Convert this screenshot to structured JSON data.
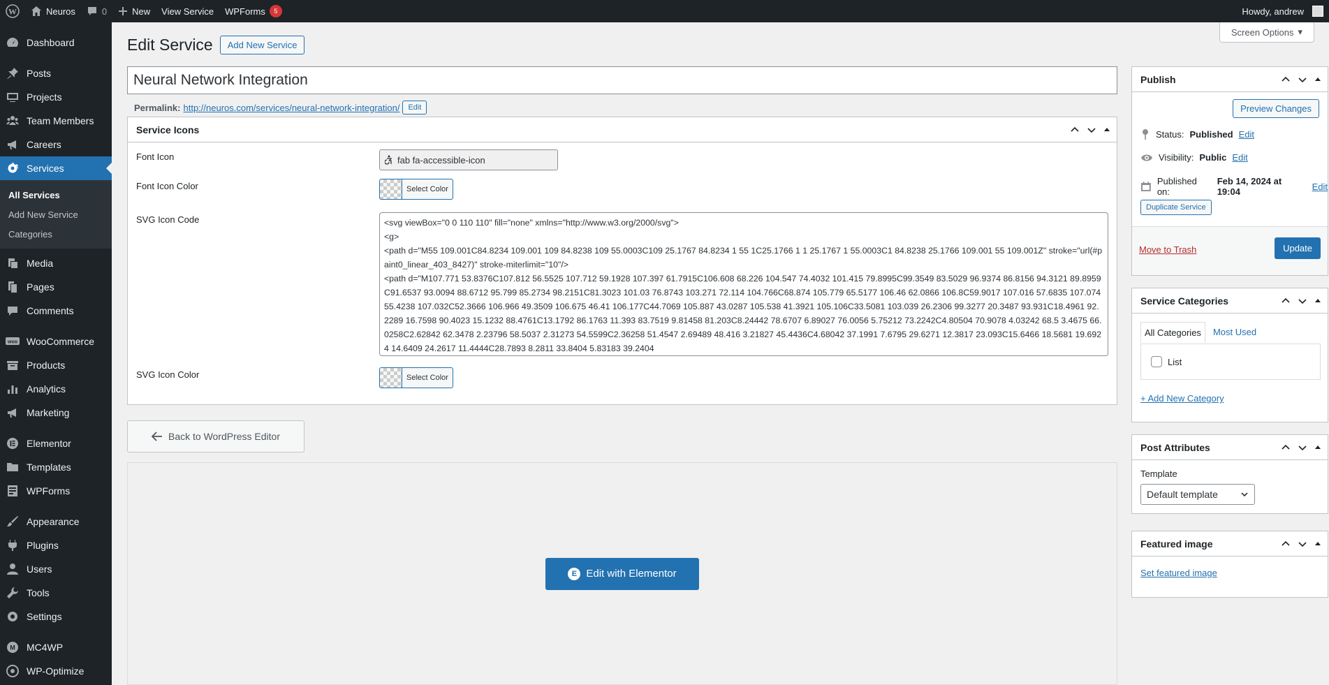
{
  "adminbar": {
    "site_name": "Neuros",
    "comments_count": "0",
    "new_label": "New",
    "view_label": "View Service",
    "wpforms_label": "WPForms",
    "wpforms_badge": "5",
    "howdy": "Howdy, andrew"
  },
  "sidebar": {
    "dashboard": "Dashboard",
    "posts": "Posts",
    "projects": "Projects",
    "team_members": "Team Members",
    "careers": "Careers",
    "services": "Services",
    "sub_all": "All Services",
    "sub_add": "Add New Service",
    "sub_categories": "Categories",
    "media": "Media",
    "pages": "Pages",
    "comments": "Comments",
    "woocommerce": "WooCommerce",
    "products": "Products",
    "analytics": "Analytics",
    "marketing": "Marketing",
    "elementor": "Elementor",
    "templates": "Templates",
    "wpforms": "WPForms",
    "appearance": "Appearance",
    "plugins": "Plugins",
    "users": "Users",
    "tools": "Tools",
    "settings": "Settings",
    "mc4wp": "MC4WP",
    "wp_optimize": "WP-Optimize"
  },
  "header": {
    "title": "Edit Service",
    "add_new": "Add New Service",
    "screen_options": "Screen Options"
  },
  "post": {
    "title": "Neural Network Integration",
    "permalink_label": "Permalink:",
    "permalink_url": "http://neuros.com/services/neural-network-integration/",
    "permalink_edit": "Edit"
  },
  "service_icons": {
    "heading": "Service Icons",
    "font_icon_label": "Font Icon",
    "font_icon_value": "fab fa-accessible-icon",
    "font_icon_color_label": "Font Icon Color",
    "select_color": "Select Color",
    "svg_code_label": "SVG Icon Code",
    "svg_code": "<svg viewBox=\"0 0 110 110\" fill=\"none\" xmlns=\"http://www.w3.org/2000/svg\">\n<g>\n<path d=\"M55 109.001C84.8234 109.001 109 84.8238 109 55.0003C109 25.1767 84.8234 1 55 1C25.1766 1 1 25.1767 1 55.0003C1 84.8238 25.1766 109.001 55 109.001Z\" stroke=\"url(#paint0_linear_403_8427)\" stroke-miterlimit=\"10\"/>\n<path d=\"M107.771 53.8376C107.812 56.5525 107.712 59.1928 107.397 61.7915C106.608 68.226 104.547 74.4032 101.415 79.8995C99.3549 83.5029 96.9374 86.8156 94.3121 89.8959C91.6537 93.0094 88.6712 95.799 85.2734 98.2151C81.3023 101.03 76.8743 103.271 72.114 104.766C68.874 105.779 65.5177 106.46 62.0866 106.8C59.9017 107.016 57.6835 107.074 55.4238 107.032C52.3666 106.966 49.3509 106.675 46.41 106.177C44.7069 105.887 43.0287 105.538 41.3921 105.106C33.5081 103.039 26.2306 99.3277 20.3487 93.931C18.4961 92.2289 16.7598 90.4023 15.1232 88.4761C13.1792 86.1763 11.393 83.7519 9.81458 81.203C8.24442 78.6707 6.89027 76.0056 5.75212 73.2242C4.80504 70.9078 4.03242 68.5 3.4675 66.0258C2.62842 62.3478 2.23796 58.5037 2.31273 54.5599C2.36258 51.4547 2.69489 48.416 3.21827 45.4436C4.68042 37.1991 7.6795 29.6271 12.3817 23.093C15.6466 18.5681 19.6924 14.6409 24.2617 11.4444C28.7893 8.2811 33.8404 5.83183 39.2404",
    "svg_color_label": "SVG Icon Color"
  },
  "editor": {
    "back_label": "Back to WordPress Editor",
    "elementor_label": "Edit with Elementor"
  },
  "publish": {
    "heading": "Publish",
    "preview": "Preview Changes",
    "status_label": "Status:",
    "status_value": "Published",
    "visibility_label": "Visibility:",
    "visibility_value": "Public",
    "published_label": "Published on:",
    "published_value": "Feb 14, 2024 at 19:04",
    "edit": "Edit",
    "duplicate": "Duplicate Service",
    "trash": "Move to Trash",
    "update": "Update"
  },
  "categories": {
    "heading": "Service Categories",
    "tab_all": "All Categories",
    "tab_used": "Most Used",
    "item": "List",
    "add_new": "+ Add New Category"
  },
  "attributes": {
    "heading": "Post Attributes",
    "template_label": "Template",
    "template_value": "Default template"
  },
  "featured": {
    "heading": "Featured image",
    "set_link": "Set featured image"
  }
}
